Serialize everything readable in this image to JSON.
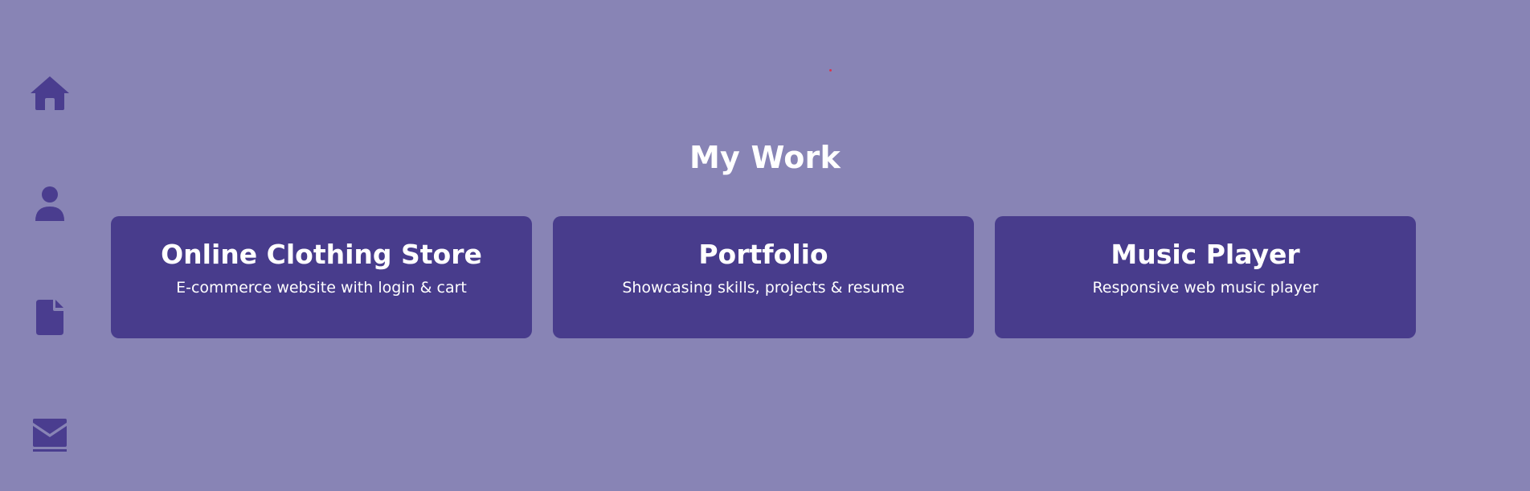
{
  "sidebar": {
    "items": [
      {
        "icon": "home-icon"
      },
      {
        "icon": "user-icon"
      },
      {
        "icon": "file-icon"
      },
      {
        "icon": "envelope-icon"
      }
    ]
  },
  "main": {
    "title": "My Work",
    "projects": [
      {
        "title": "Online Clothing Store",
        "description": "E-commerce website with login & cart"
      },
      {
        "title": "Portfolio",
        "description": "Showcasing skills, projects & resume"
      },
      {
        "title": "Music Player",
        "description": "Responsive web music player"
      }
    ]
  },
  "colors": {
    "background": "#8884b5",
    "card": "#483c8c",
    "icon": "#4a3d8f",
    "text": "#ffffff"
  }
}
